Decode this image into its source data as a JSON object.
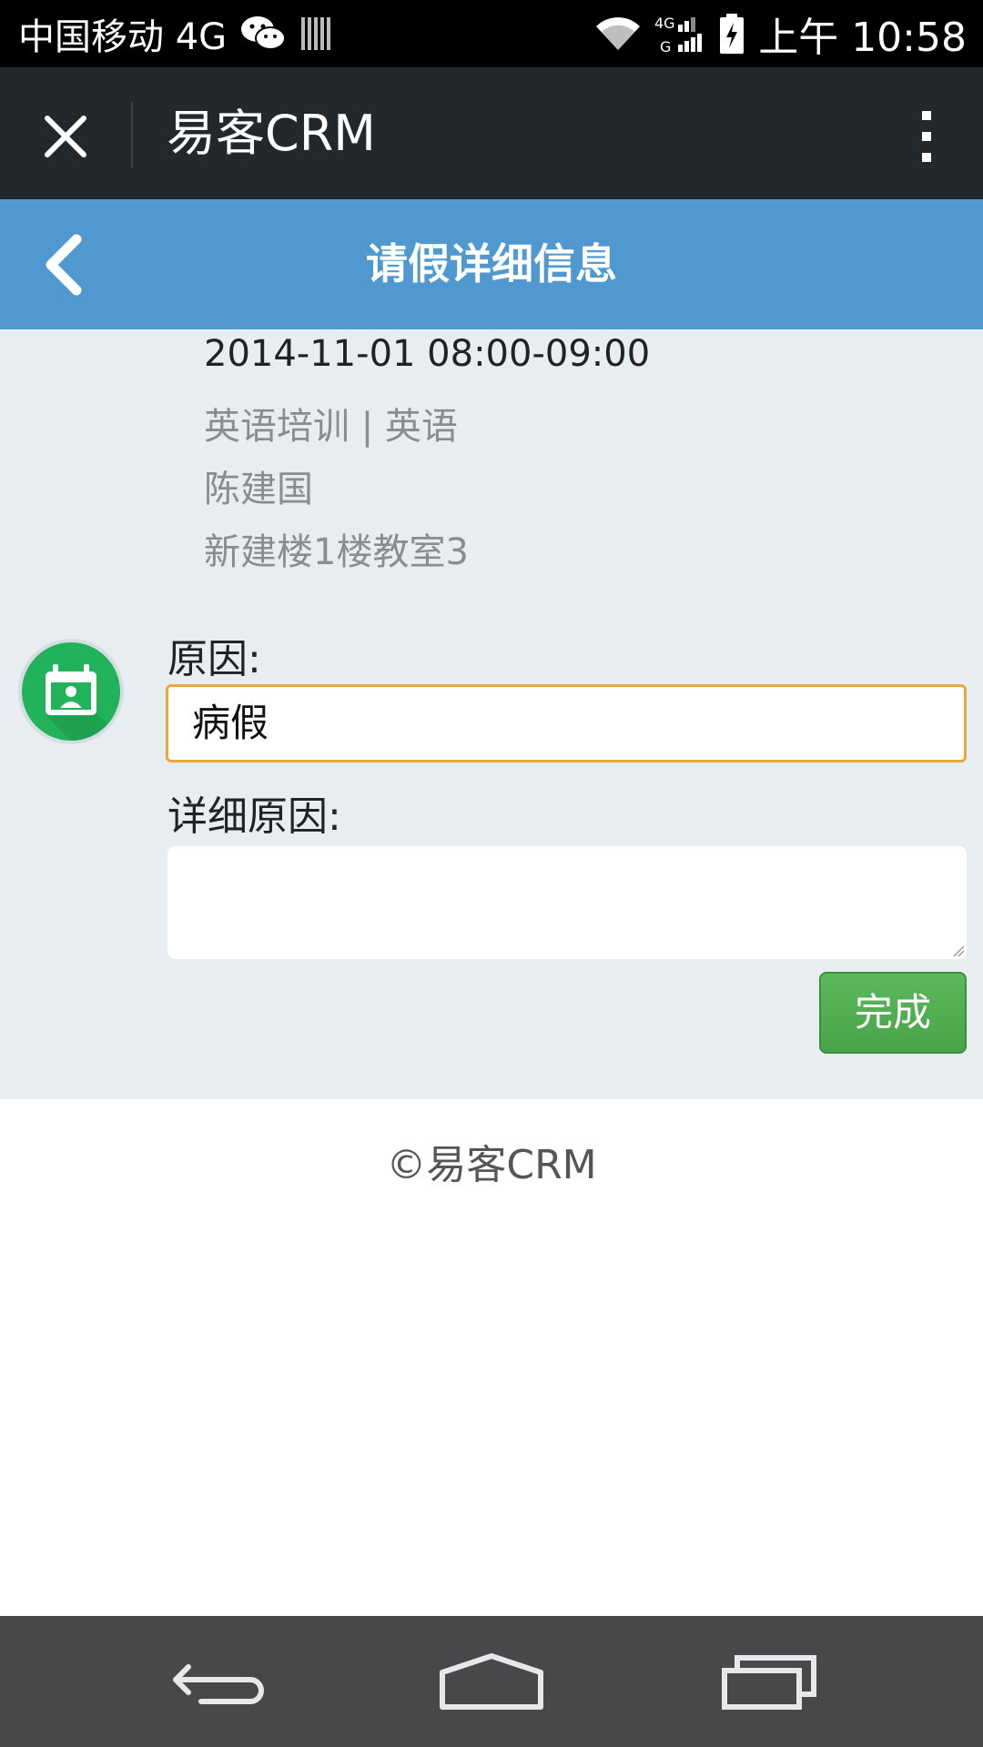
{
  "status_bar": {
    "carrier": "中国移动 4G",
    "time": "上午 10:58",
    "network_label_top": "4G",
    "network_label_bottom": "G"
  },
  "app_bar": {
    "title": "易客CRM"
  },
  "header": {
    "title": "请假详细信息"
  },
  "lesson": {
    "datetime": "2014-11-01 08:00-09:00",
    "course": "英语培训 | 英语",
    "teacher": "陈建国",
    "room": "新建楼1楼教室3"
  },
  "form": {
    "reason_label": "原因:",
    "reason_value": "病假",
    "detail_label": "详细原因:",
    "detail_value": "",
    "submit_label": "完成"
  },
  "footer": {
    "copyright": "©易客CRM"
  },
  "colors": {
    "header_blue": "#4f98d0",
    "app_bar_dark": "#22282c",
    "content_bg": "#e8edf1",
    "input_focus": "#e8a93a",
    "button_green": "#5cb85c",
    "avatar_green": "#22b35a"
  },
  "icons": {
    "close": "close-icon",
    "more": "more-vertical-icon",
    "back": "chevron-left-icon",
    "avatar": "calendar-contact-icon",
    "nav_back": "back-arrow-icon",
    "nav_home": "home-icon",
    "nav_recent": "recent-apps-icon"
  }
}
